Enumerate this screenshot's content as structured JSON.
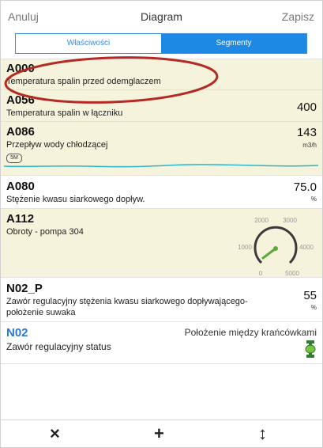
{
  "header": {
    "cancel": "Anuluj",
    "title": "Diagram",
    "save": "Zapisz"
  },
  "tabs": {
    "properties": "Właściwości",
    "segments": "Segmenty"
  },
  "rows": [
    {
      "code": "A000",
      "desc": "Temperatura spalin przed odemglaczem"
    },
    {
      "code": "A056",
      "desc": "Temperatura spalin w łączniku",
      "value": "400"
    },
    {
      "code": "A086",
      "desc": "Przepływ wody chłodzącej",
      "value": "143",
      "unit": "m3/h",
      "badge": "5M"
    },
    {
      "code": "A080",
      "desc": "Stężenie kwasu siarkowego dopływ.",
      "value": "75.0",
      "unit": "%"
    },
    {
      "code": "A112",
      "desc": "Obroty - pompa 304",
      "gauge": {
        "labels": [
          "2000",
          "3000",
          "1000",
          "4000",
          "0",
          "5000"
        ]
      }
    },
    {
      "code": "N02_P",
      "desc1": "Zawór regulacyjny stężenia kwasu siarkowego dopływającego-",
      "desc2": "położenie suwaka",
      "value": "55",
      "unit": "%"
    },
    {
      "code": "N02",
      "desc": "Zawór regulacyjny status",
      "status": "Położenie między krańcówkami"
    }
  ],
  "toolbar": {
    "close_icon": "×",
    "add_icon": "+",
    "sort_icon": "↕"
  },
  "colors": {
    "accent": "#1e88e5",
    "highlight_row": "#f6f3dc",
    "annotation": "#b52a24",
    "trend": "#29b6c9",
    "gauge_needle": "#5aa83a"
  }
}
